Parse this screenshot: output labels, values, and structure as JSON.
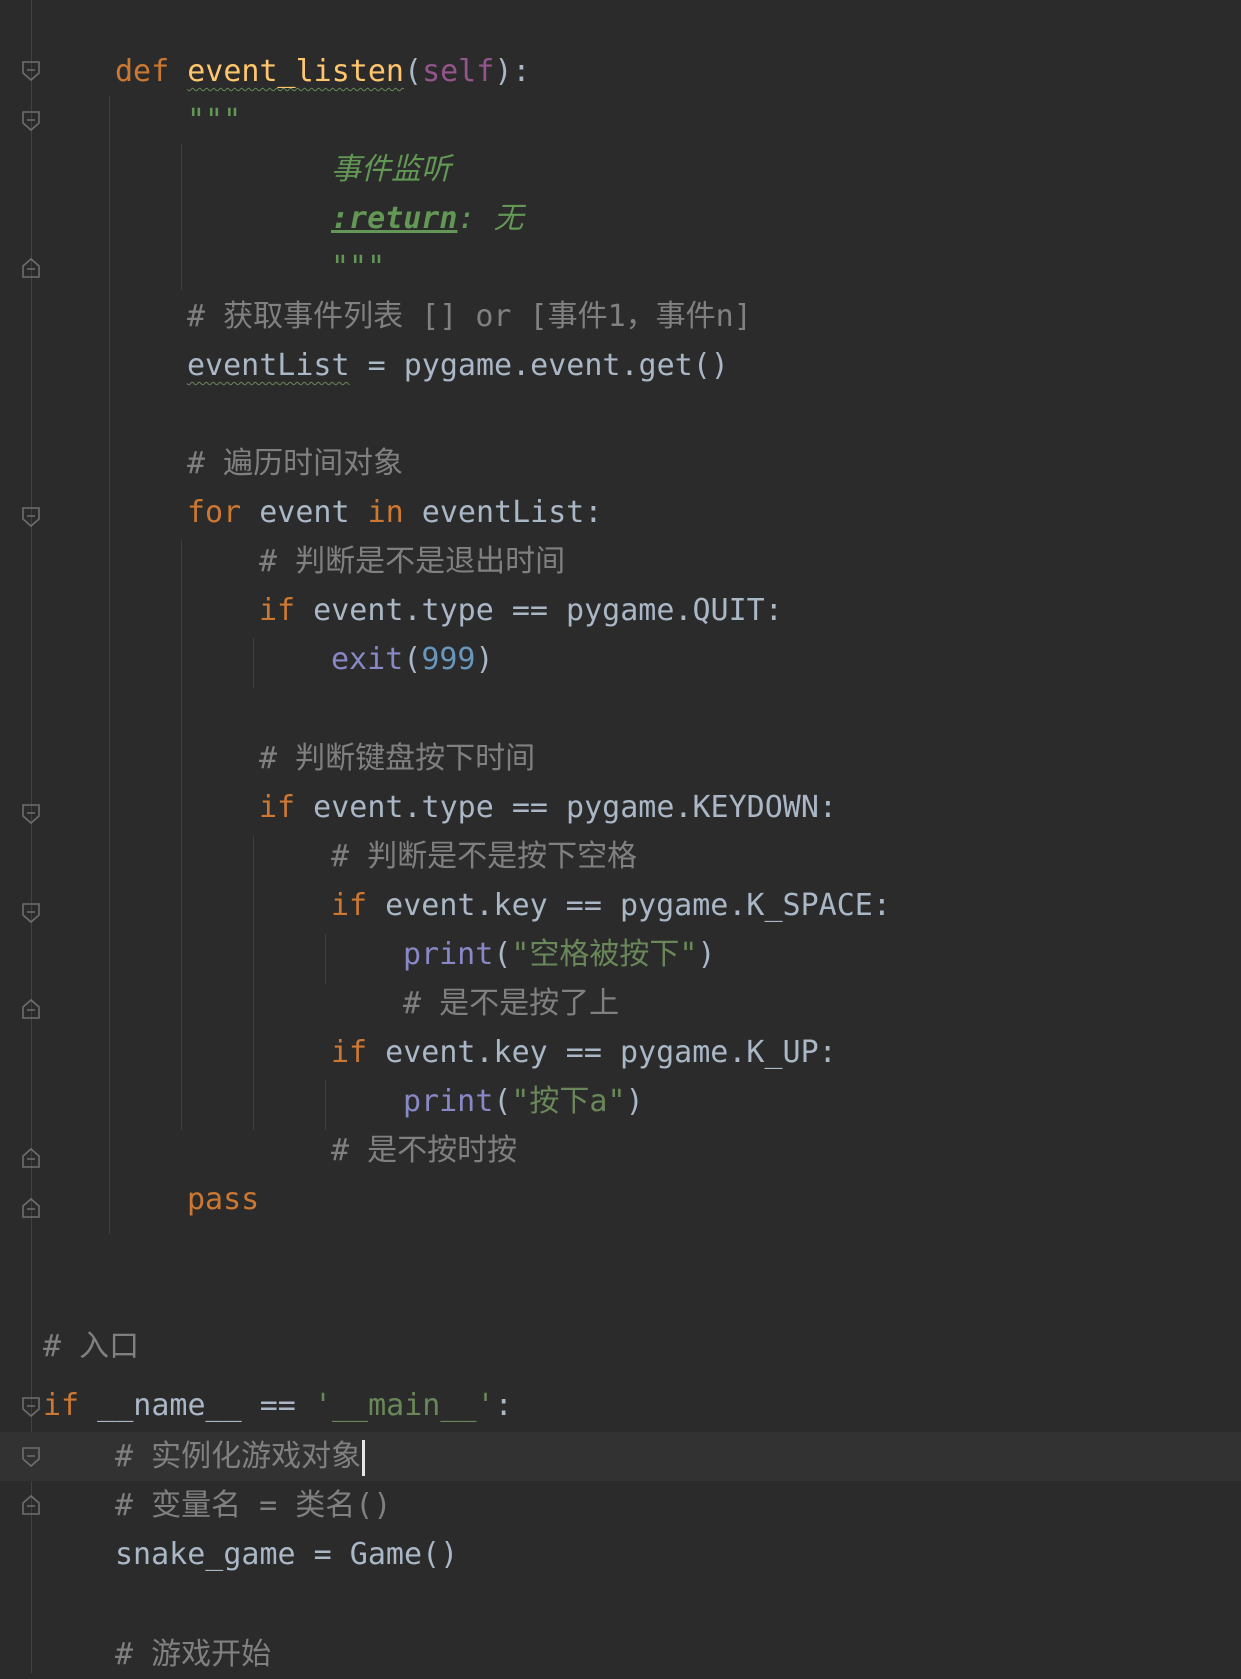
{
  "code": {
    "def_kw": "def",
    "def_name": "event_listen",
    "def_open": "(",
    "def_self": "self",
    "def_close": "):",
    "doc_open": "\"\"\"",
    "doc_line1": "事件监听",
    "doc_tag": ":return",
    "doc_tag_rest": ": 无",
    "doc_close": "\"\"\"",
    "cmt_get_events": "# 获取事件列表 [] or [事件1，事件n]",
    "eventlist_var": "eventList",
    "eventlist_rest": " = pygame.event.get()",
    "cmt_traverse": "# 遍历时间对象",
    "for_kw": "for",
    "for_mid": " event ",
    "in_kw": "in",
    "for_rest": " eventList:",
    "cmt_quit": "# 判断是不是退出时间",
    "if_kw": "if",
    "if_quit_rest": " event.type == pygame.QUIT:",
    "exit_fn": "exit",
    "exit_open": "(",
    "exit_num": "999",
    "exit_close": ")",
    "cmt_keydown": "# 判断键盘按下时间",
    "if_keydown_rest": " event.type == pygame.KEYDOWN:",
    "cmt_space": "# 判断是不是按下空格",
    "if_space_rest": " event.key == pygame.K_SPACE:",
    "print_fn": "print",
    "print_open": "(",
    "print_space_str": "\"空格被按下\"",
    "print_close": ")",
    "cmt_up": "# 是不是按了上",
    "if_up_rest": " event.key == pygame.K_UP:",
    "print_a_str": "\"按下a\"",
    "cmt_press": "# 是不按时按",
    "pass_kw": "pass",
    "cmt_entry": "# 入口",
    "main_if_kw": "if",
    "main_mid": " __name__ == ",
    "main_str": "'__main__'",
    "main_colon": ":",
    "cmt_instantiate": "# 实例化游戏对象",
    "cmt_varname": "# 变量名 = 类名()",
    "snake_line": "snake_game = Game()",
    "cmt_start": "# 游戏开始"
  },
  "colors": {
    "background": "#2b2b2b",
    "keyword": "#cc7832",
    "function": "#ffc66d",
    "comment": "#808080",
    "docstring": "#629755",
    "string": "#6a8759",
    "number": "#6897bb",
    "builtin": "#8888c6",
    "self": "#94558d",
    "text": "#a9b7c6"
  }
}
